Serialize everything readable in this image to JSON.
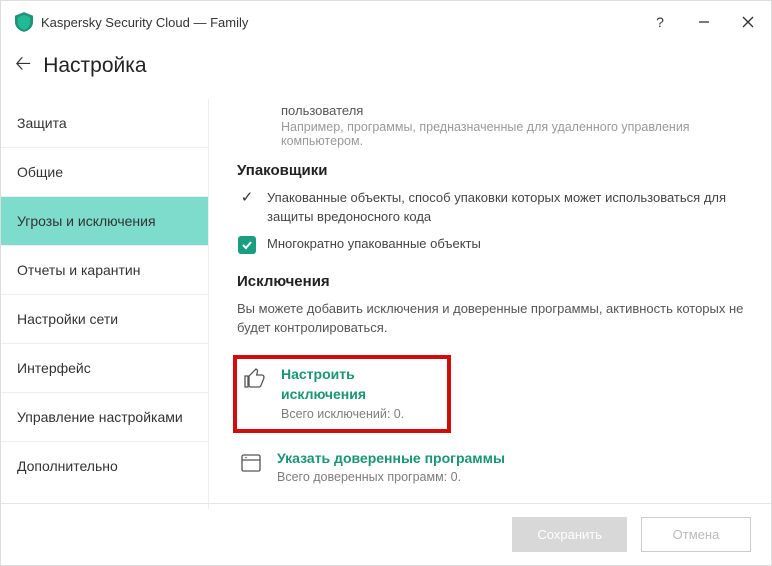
{
  "titlebar": {
    "product": "Kaspersky Security Cloud — Family"
  },
  "header": {
    "title": "Настройка"
  },
  "sidebar": {
    "items": [
      {
        "label": "Защита"
      },
      {
        "label": "Общие"
      },
      {
        "label": "Угрозы и исключения"
      },
      {
        "label": "Отчеты и карантин"
      },
      {
        "label": "Настройки сети"
      },
      {
        "label": "Интерфейс"
      },
      {
        "label": "Управление настройками"
      },
      {
        "label": "Дополнительно"
      }
    ]
  },
  "main": {
    "user_line": "пользователя",
    "user_hint": "Например, программы, предназначенные для удаленного управления компьютером.",
    "packers": {
      "title": "Упаковщики",
      "item1": "Упакованные объекты, способ упаковки которых может использоваться для защиты вредоносного кода",
      "item2": "Многократно упакованные объекты"
    },
    "exclusions": {
      "title": "Исключения",
      "desc": "Вы можете добавить исключения и доверенные программы, активность которых не будет контролироваться.",
      "configure": {
        "label": "Настроить исключения",
        "sub": "Всего исключений: 0."
      },
      "trusted": {
        "label": "Указать доверенные программы",
        "sub": "Всего доверенных программ: 0."
      }
    }
  },
  "footer": {
    "save": "Сохранить",
    "cancel": "Отмена"
  }
}
